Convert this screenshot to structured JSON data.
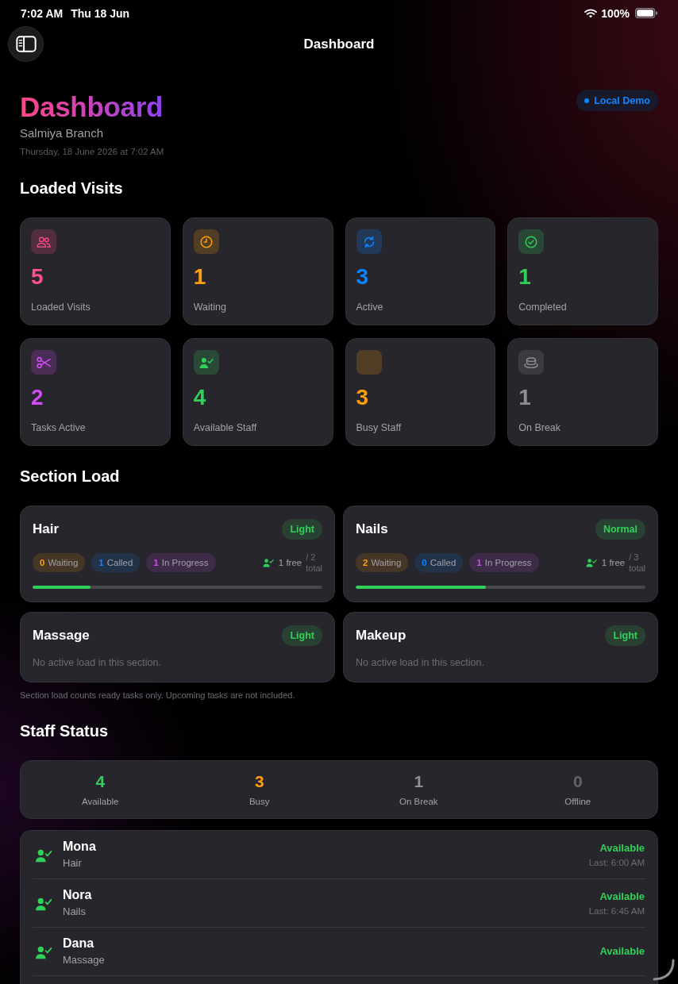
{
  "status_bar": {
    "time": "7:02 AM",
    "date": "Thu 18 Jun",
    "battery": "100%"
  },
  "nav_bar": {
    "title": "Dashboard"
  },
  "header": {
    "title": "Dashboard",
    "branch": "Salmiya Branch",
    "timestamp": "Thursday, 18 June 2026 at 7:02 AM",
    "badge": "Local Demo"
  },
  "loaded_visits": {
    "title": "Loaded Visits",
    "stats": [
      {
        "value": "5",
        "label": "Loaded Visits",
        "color": "#ff4f8e"
      },
      {
        "value": "1",
        "label": "Waiting",
        "color": "#ff9f0a"
      },
      {
        "value": "3",
        "label": "Active",
        "color": "#0a84ff"
      },
      {
        "value": "1",
        "label": "Completed",
        "color": "#30d158"
      },
      {
        "value": "2",
        "label": "Tasks Active",
        "color": "#d04cf3"
      },
      {
        "value": "4",
        "label": "Available Staff",
        "color": "#30d158"
      },
      {
        "value": "3",
        "label": "Busy Staff",
        "color": "#ff9f0a"
      },
      {
        "value": "1",
        "label": "On Break",
        "color": "#8e8e93"
      }
    ]
  },
  "section_load": {
    "title": "Section Load",
    "sections": [
      {
        "kind": "load",
        "name": "Hair",
        "load": {
          "label": "Light",
          "color": "#30d158"
        },
        "chips": [
          {
            "count": "0",
            "label": "Waiting",
            "color": "#ff9f0a"
          },
          {
            "count": "1",
            "label": "Called",
            "color": "#0a84ff"
          },
          {
            "count": "1",
            "label": "In Progress",
            "color": "#c84ff0"
          }
        ],
        "free": "1 free",
        "total": "/ 2 total",
        "level": 0.2
      },
      {
        "kind": "load",
        "name": "Nails",
        "load": {
          "label": "Normal",
          "color": "#30d158"
        },
        "chips": [
          {
            "count": "2",
            "label": "Waiting",
            "color": "#ff9f0a"
          },
          {
            "count": "0",
            "label": "Called",
            "color": "#0a84ff"
          },
          {
            "count": "1",
            "label": "In Progress",
            "color": "#c84ff0"
          }
        ],
        "free": "1 free",
        "total": "/ 3 total",
        "level": 0.45
      },
      {
        "kind": "empty",
        "name": "Massage",
        "load": {
          "label": "Light",
          "color": "#30d158"
        },
        "message": "No active load in this section."
      },
      {
        "kind": "empty",
        "name": "Makeup",
        "load": {
          "label": "Light",
          "color": "#30d158"
        },
        "message": "No active load in this section."
      }
    ],
    "note": "Section load counts ready tasks only. Upcoming tasks are not included."
  },
  "staff_status": {
    "title": "Staff Status",
    "summary": [
      {
        "value": "4",
        "label": "Available",
        "color": "#30d158"
      },
      {
        "value": "3",
        "label": "Busy",
        "color": "#ff9f0a"
      },
      {
        "value": "1",
        "label": "On Break",
        "color": "#8e8e93"
      },
      {
        "value": "0",
        "label": "Offline",
        "color": "#636366"
      }
    ],
    "staff": [
      {
        "name": "Mona",
        "section": "Hair",
        "status": "Available",
        "color": "#30d158",
        "last": "Last: 6:00 AM"
      },
      {
        "name": "Nora",
        "section": "Nails",
        "status": "Available",
        "color": "#30d158",
        "last": "Last: 6:45 AM"
      },
      {
        "name": "Dana",
        "section": "Massage",
        "status": "Available",
        "color": "#30d158"
      }
    ]
  }
}
